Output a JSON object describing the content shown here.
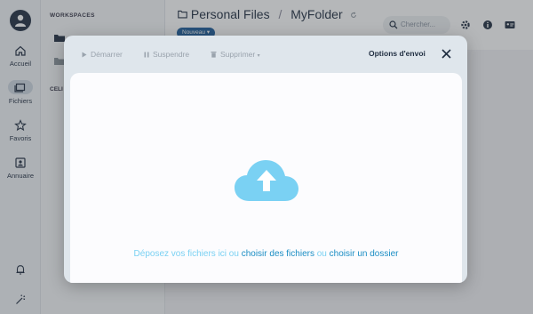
{
  "rail": {
    "items": [
      {
        "label": "Accueil"
      },
      {
        "label": "Fichiers"
      },
      {
        "label": "Favoris"
      },
      {
        "label": "Annuaire"
      }
    ]
  },
  "sidepanel": {
    "workspaces_title": "WORKSPACES",
    "cells_title": "CELI"
  },
  "header": {
    "crumb_root": "Personal Files",
    "crumb_sep": "/",
    "crumb_current": "MyFolder",
    "new_button": "Nouveau",
    "search_placeholder": "Chercher..."
  },
  "modal": {
    "toolbar": {
      "start": "Démarrer",
      "pause": "Suspendre",
      "delete": "Supprimer",
      "options": "Options d'envoi"
    },
    "dropzone": {
      "text_prefix": "Déposez vos fichiers ici ou",
      "choose_files": "choisir des fichiers",
      "text_or": "ou",
      "choose_folder": "choisir un dossier"
    }
  },
  "colors": {
    "accent": "#1a8dc4",
    "cloud": "#7ad1f3",
    "primary_dark": "#1f2d40",
    "new_button": "#1a5b99"
  }
}
